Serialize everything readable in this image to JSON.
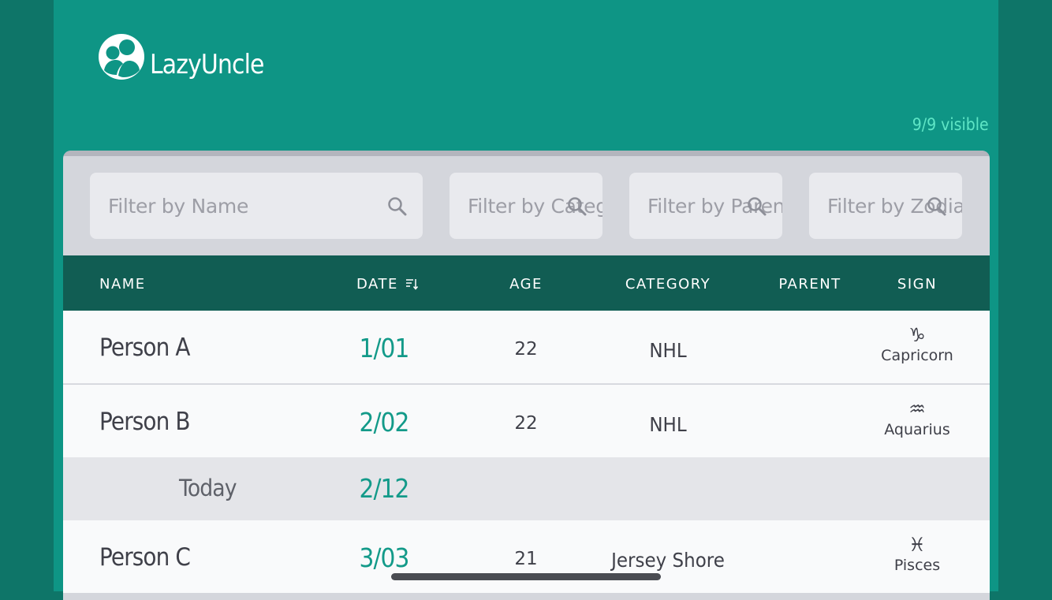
{
  "brand": {
    "name": "LazyUncle",
    "logo_icon": "people-logo-icon"
  },
  "visible_count": "9/9 visible",
  "filters": {
    "name_placeholder": "Filter by Name",
    "category_placeholder": "Filter by Category",
    "parent_placeholder": "Filter by Parent",
    "zodiac_placeholder": "Filter by Zodiac",
    "icon": "search-icon"
  },
  "columns": {
    "name": "NAME",
    "date": "DATE",
    "age": "AGE",
    "category": "CATEGORY",
    "parent": "PARENT",
    "sign": "SIGN",
    "date_sort_icon": "sort-descending-icon"
  },
  "rows": [
    {
      "name": "Person A",
      "date": "1/01",
      "age": "22",
      "category": "NHL",
      "parent": "",
      "sign_symbol": "♑",
      "sign_name": "Capricorn"
    },
    {
      "name": "Person B",
      "date": "2/02",
      "age": "22",
      "category": "NHL",
      "parent": "",
      "sign_symbol": "♒",
      "sign_name": "Aquarius"
    },
    {
      "name": "Person C",
      "date": "3/03",
      "age": "21",
      "category": "Jersey Shore",
      "parent": "",
      "sign_symbol": "♓",
      "sign_name": "Pisces"
    }
  ],
  "today_row": {
    "label": "Today",
    "date": "2/12"
  },
  "colors": {
    "background": "#0e7568",
    "app_background": "#0e9585",
    "header_row": "#115d53",
    "accent_date": "#139a89",
    "visible_count": "#5fe6c6"
  }
}
